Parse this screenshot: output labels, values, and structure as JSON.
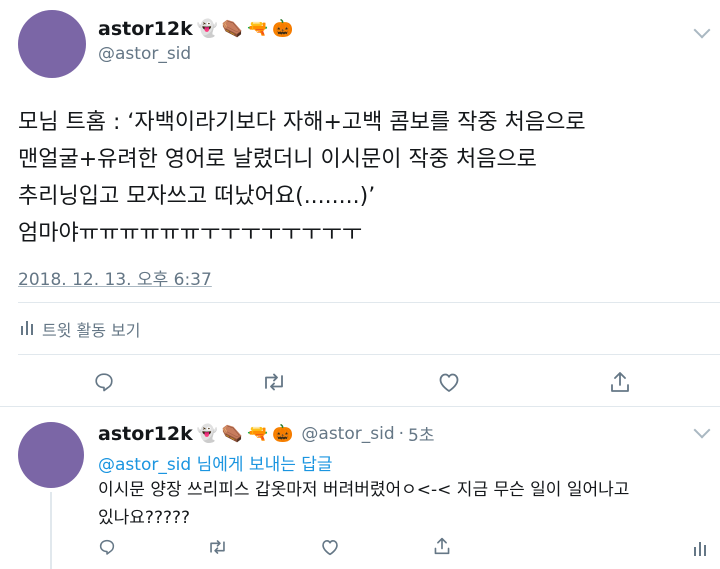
{
  "main_tweet": {
    "display_name": "astor12k",
    "name_emojis": [
      "👻",
      "⚰️",
      "🔫",
      "🎃"
    ],
    "handle": "@astor_sid",
    "text_lines": [
      "모님 트홈 : ‘자백이라기보다 자해+고백 콤보를 작중 처음으로",
      "맨얼굴+유려한 영어로 날렸더니 이시문이 작중 처음으로",
      "추리닝입고 모자쓰고 떠났어요(........)’",
      "엄마야ㅠㅠㅠㅠㅠㅠㅜㅜㅜㅜㅜㅜㅜㅜ"
    ],
    "timestamp": "2018. 12. 13. 오후 6:37",
    "activity_label": "트윗 활동 보기"
  },
  "reply_tweet": {
    "display_name": "astor12k",
    "name_emojis": [
      "👻",
      "⚰️",
      "🔫",
      "🎃"
    ],
    "handle": "@astor_sid",
    "separator": "·",
    "time_ago": "5초",
    "reply_to_mention": "@astor_sid",
    "reply_to_suffix": "님에게 보내는 답글",
    "text": "이시문 양장 쓰리피스 갑옷마저 버려버렸어ㅇ<-< 지금 무슨 일이 일어나고\n있나요?????"
  },
  "icons": {
    "reply": "reply-icon",
    "retweet": "retweet-icon",
    "like": "like-icon",
    "share": "share-icon",
    "analytics": "analytics-icon",
    "menu": "chevron-down-icon"
  },
  "colors": {
    "avatar": "#7b66a6",
    "link": "#1b95e0",
    "secondary_text": "#657786",
    "icon": "#657786",
    "divider": "#e1e8ed"
  }
}
